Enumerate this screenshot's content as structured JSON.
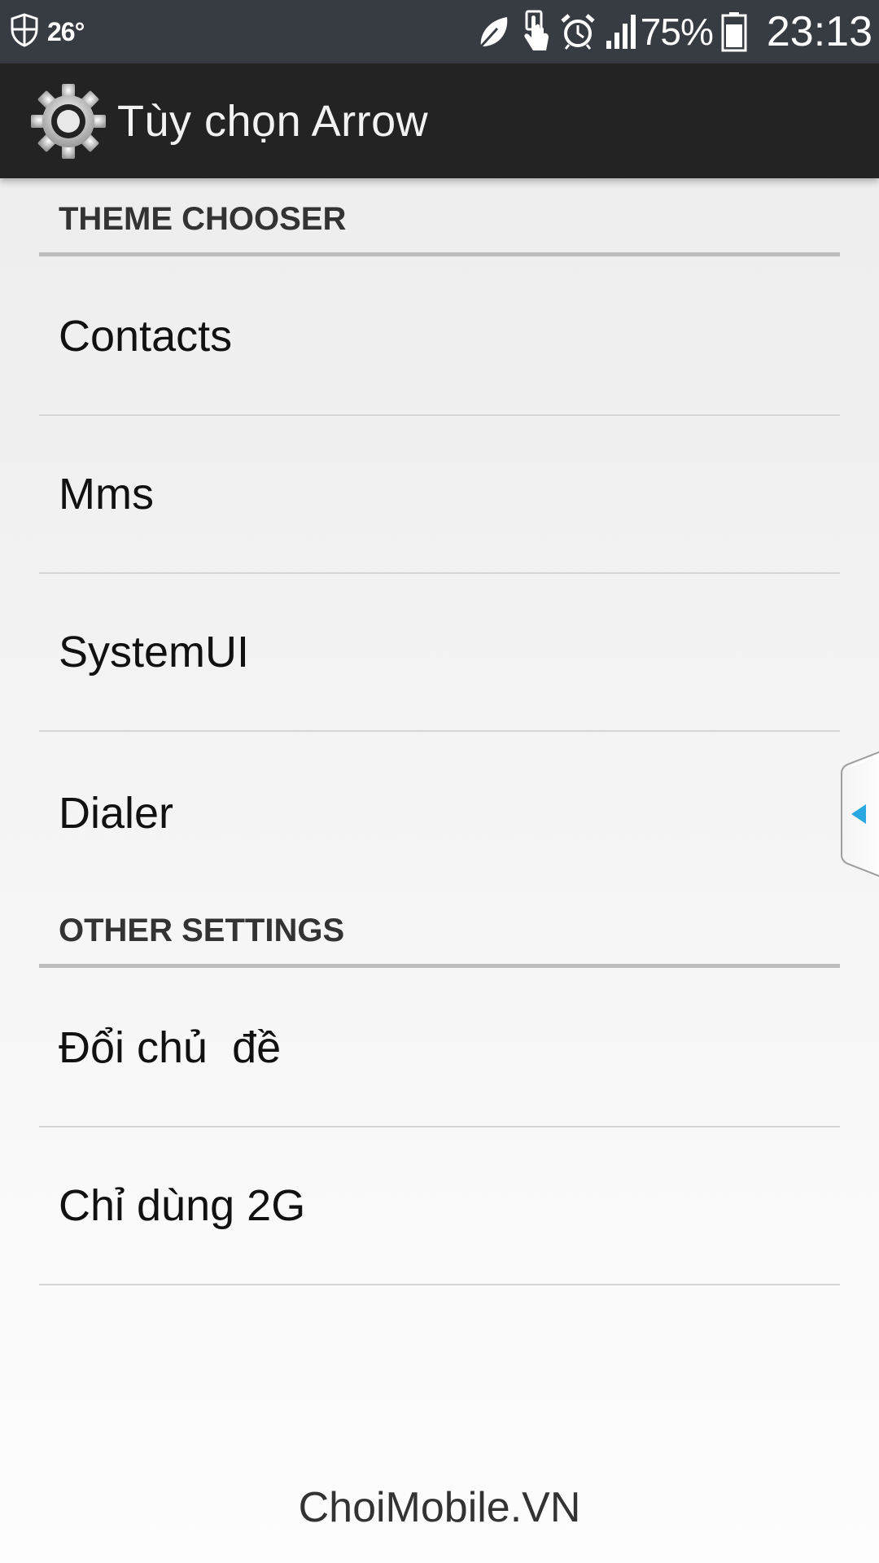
{
  "status_bar": {
    "temperature": "26°",
    "battery_percent": "75%",
    "time": "23:13",
    "icons": [
      "shield-icon",
      "leaf-icon",
      "touch-icon",
      "alarm-clock-icon",
      "signal-icon",
      "battery-icon"
    ]
  },
  "action_bar": {
    "icon": "gear-icon",
    "title": "Tùy chọn Arrow"
  },
  "sections": {
    "theme_chooser": {
      "header": "THEME CHOOSER",
      "items": [
        "Contacts",
        "Mms",
        "SystemUI",
        "Dialer"
      ]
    },
    "other_settings": {
      "header": "OTHER SETTINGS",
      "items": [
        "Đổi chủ  đề",
        "Chỉ dùng 2G"
      ]
    }
  },
  "side_handle": {
    "icon": "left-arrow-icon",
    "accent_color": "#29a7e1"
  },
  "watermark": "ChoiMobile.VN"
}
